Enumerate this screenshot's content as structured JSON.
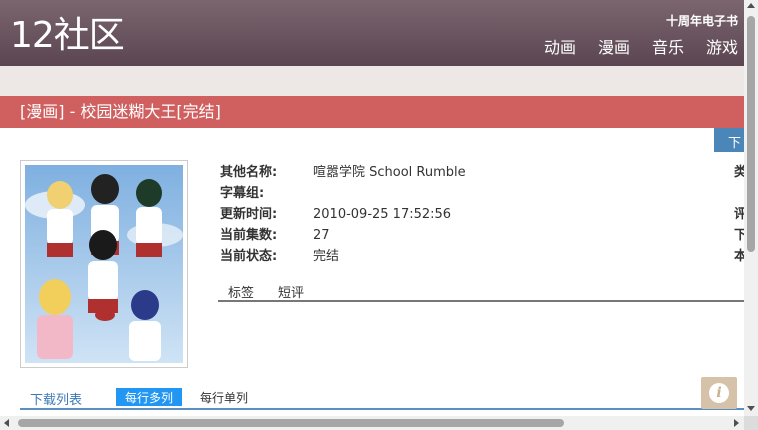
{
  "site": {
    "logo": "12社区",
    "top_link": "十周年电子书"
  },
  "nav": [
    {
      "label": "动画"
    },
    {
      "label": "漫画"
    },
    {
      "label": "音乐"
    },
    {
      "label": "游戏"
    }
  ],
  "title": "[漫画] - 校园迷糊大王[完结]",
  "download_button_label": "下",
  "info": [
    {
      "label": "其他名称:",
      "value": "喧嚣学院 School Rumble",
      "right": "类"
    },
    {
      "label": "字幕组:",
      "value": "",
      "right": ""
    },
    {
      "label": "更新时间:",
      "value": "2010-09-25 17:52:56",
      "right": "评"
    },
    {
      "label": "当前集数:",
      "value": "27",
      "right": "下"
    },
    {
      "label": "当前状态:",
      "value": "完结",
      "right": "本"
    }
  ],
  "tabs": [
    {
      "label": "标签"
    },
    {
      "label": "短评"
    }
  ],
  "download_list": {
    "label": "下载列表",
    "mode_multi": "每行多列",
    "mode_single": "每行单列"
  },
  "info_fab": {
    "glyph": "i"
  },
  "colors": {
    "header": "#6b5560",
    "title_bar": "#d06060",
    "accent_blue": "#2196f3",
    "link_blue": "#3a7ab8"
  }
}
